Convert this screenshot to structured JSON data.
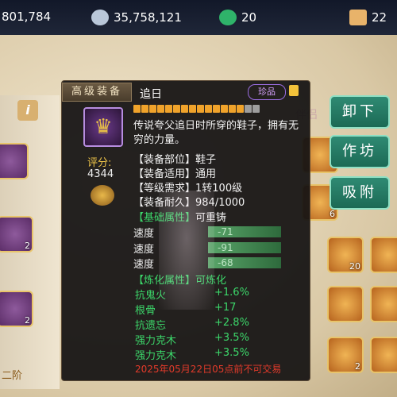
{
  "currencies": [
    {
      "value": "801,784",
      "icon": "gold-icon",
      "color": "#e0b04a"
    },
    {
      "value": "35,758,121",
      "icon": "silver-icon",
      "color": "#b9c7d9"
    },
    {
      "value": "20",
      "icon": "jade-icon",
      "color": "#2fb36a"
    },
    {
      "value": "22",
      "icon": "ticket-icon",
      "color": "#e8b36a"
    }
  ],
  "side_tab": {
    "info_label": "i",
    "right_tab_label": "伴侣"
  },
  "buttons": {
    "unequip": "卸下",
    "workshop": "作坊",
    "absorb": "吸附"
  },
  "tooltip": {
    "tag": "高级装备",
    "name": "追日",
    "rarity": "珍品",
    "star_bar": {
      "filled": 14,
      "total": 16,
      "filled_color": "#f0a32b",
      "empty_color": "#9e9e9e"
    },
    "description": "传说夸父追日时所穿的鞋子，拥有无穷的力量。",
    "score_label": "评分:",
    "score_value": "4344",
    "attributes": [
      "【装备部位】鞋子",
      "【装备适用】通用",
      "【等级需求】1转100级",
      "【装备耐久】984/1000"
    ],
    "base_header": {
      "bracket": "【基础属性】",
      "note": "可重铸"
    },
    "base_stats": [
      {
        "name": "速度",
        "value": "-71"
      },
      {
        "name": "速度",
        "value": "-91"
      },
      {
        "name": "速度",
        "value": "-68"
      }
    ],
    "refine_header": {
      "bracket": "【炼化属性】",
      "note": "可炼化"
    },
    "refine_stats": [
      {
        "name": "抗鬼火",
        "value": "+1.6%"
      },
      {
        "name": "根骨",
        "value": "+17"
      },
      {
        "name": "抗遗忘",
        "value": "+2.8%"
      },
      {
        "name": "强力克木",
        "value": "+3.5%"
      },
      {
        "name": "强力克木",
        "value": "+3.5%"
      }
    ],
    "trade_limit": "2025年05月22日05点前不可交易"
  },
  "left_slots": [
    {
      "count": ""
    },
    {
      "count": "2"
    },
    {
      "count": "2"
    }
  ],
  "grid_counts": {
    "a": "6",
    "b": "20",
    "c": "2"
  },
  "level_label": "二阶"
}
